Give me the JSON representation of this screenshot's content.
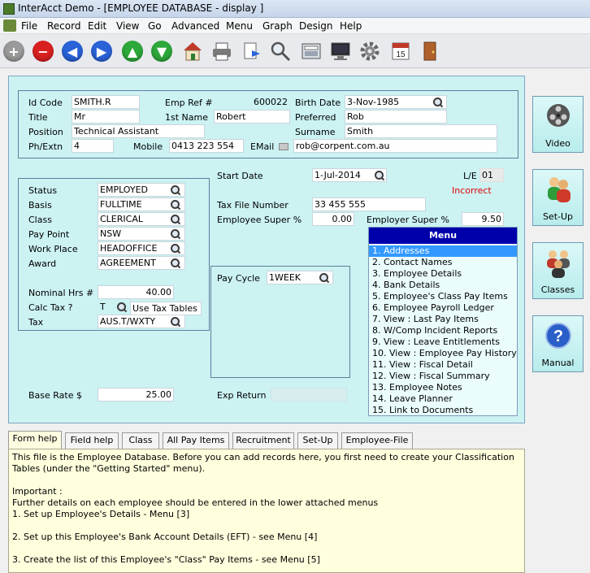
{
  "window": {
    "title": "InterAcct Demo - [EMPLOYEE DATABASE - display ]"
  },
  "menubar": [
    "File",
    "Record",
    "Edit",
    "View",
    "Go",
    "Advanced",
    "Menu",
    "Graph",
    "Design",
    "Help"
  ],
  "toolbar": {
    "buttons": [
      "add-icon",
      "delete-icon",
      "previous-icon",
      "next-icon",
      "up-icon",
      "down-icon",
      "home-icon",
      "print-icon",
      "document-icon",
      "search-icon",
      "calculator-icon",
      "monitor-icon",
      "settings-icon",
      "calendar-icon",
      "exit-door-icon"
    ],
    "calendar_day": "15"
  },
  "employee": {
    "labels": {
      "id_code": "Id Code",
      "title": "Title",
      "position": "Position",
      "ph_extn": "Ph/Extn",
      "emp_ref": "Emp Ref #",
      "first_name": "1st Name",
      "mobile": "Mobile",
      "email": "EMail",
      "birth_date": "Birth Date",
      "preferred": "Preferred",
      "surname": "Surname"
    },
    "id_code": "SMITH.R",
    "title": "Mr",
    "position": "Technical Assistant",
    "ph_extn": "4",
    "emp_ref": "600022",
    "first_name": "Robert",
    "mobile": "0413 223 554",
    "email": "rob@corpent.com.au",
    "birth_date": "3-Nov-1985",
    "preferred": "Rob",
    "surname": "Smith"
  },
  "classification": {
    "labels": {
      "status": "Status",
      "basis": "Basis",
      "class": "Class",
      "pay_point": "Pay Point",
      "work_place": "Work Place",
      "award": "Award",
      "nominal_hrs": "Nominal Hrs #",
      "calc_tax": "Calc Tax ?",
      "tax": "Tax"
    },
    "status": "EMPLOYED",
    "basis": "FULLTIME",
    "class": "CLERICAL",
    "pay_point": "NSW",
    "work_place": "HEADOFFICE",
    "award": "AGREEMENT",
    "nominal_hrs": "40.00",
    "calc_tax": "T",
    "use_tax_tables": "Use Tax Tables",
    "tax": "AUS.T/WXTY"
  },
  "employment": {
    "labels": {
      "start_date": "Start Date",
      "le": "L/E",
      "tax_file": "Tax File Number",
      "employee_super": "Employee Super %",
      "employer_super": "Employer Super %",
      "pay_cycle": "Pay Cycle",
      "base_rate": "Base Rate $",
      "exp_return": "Exp Return"
    },
    "start_date": "1-Jul-2014",
    "le": "01",
    "le_status": "Incorrect",
    "tax_file": "33 455 555",
    "employee_super": "0.00",
    "employer_super": "9.50",
    "pay_cycle": "1WEEK",
    "base_rate": "25.00",
    "exp_return": ""
  },
  "menu": {
    "title": "Menu",
    "items": [
      "1. Addresses",
      "2. Contact Names",
      "3. Employee Details",
      "4. Bank Details",
      "5. Employee's Class Pay Items",
      "6. Employee Payroll Ledger",
      "7. View : Last Pay Items",
      "8. W/Comp Incident Reports",
      "9. View : Leave Entitlements",
      "10. View : Employee Pay History",
      "11. View : Fiscal Detail",
      "12. View : Fiscal Summary",
      "13. Employee Notes",
      "14. Leave Planner",
      "15. Link to Documents"
    ],
    "selected": 0
  },
  "side_buttons": [
    {
      "label": "Video",
      "icon": "film-reel-icon"
    },
    {
      "label": "Set-Up",
      "icon": "people-setup-icon"
    },
    {
      "label": "Classes",
      "icon": "group-classes-icon"
    },
    {
      "label": "Manual",
      "icon": "help-question-icon"
    }
  ],
  "tabs": [
    "Form help",
    "Field help",
    "Class",
    "All Pay Items",
    "Recruitment",
    "Set-Up",
    "Employee-File"
  ],
  "active_tab": 0,
  "help_text": [
    "This file is the Employee Database.  Before you can add records here, you first need to create your Classification",
    "Tables (under the \"Getting Started\" menu).",
    "",
    "Important :",
    "Further details on each employee should be entered in the lower attached menus",
    "1.  Set up Employee's Details - Menu [3]",
    "",
    "2.  Set up this Employee's Bank Account Details (EFT) - see Menu [4]",
    "",
    "3.  Create the list of this Employee's \"Class\" Pay Items - see Menu [5]"
  ],
  "colors": {
    "panel": "#ccf2f2",
    "menu_header": "#0000aa",
    "menu_selected": "#3399ff",
    "incorrect": "#e00000",
    "help_bg": "#ffffdd"
  }
}
